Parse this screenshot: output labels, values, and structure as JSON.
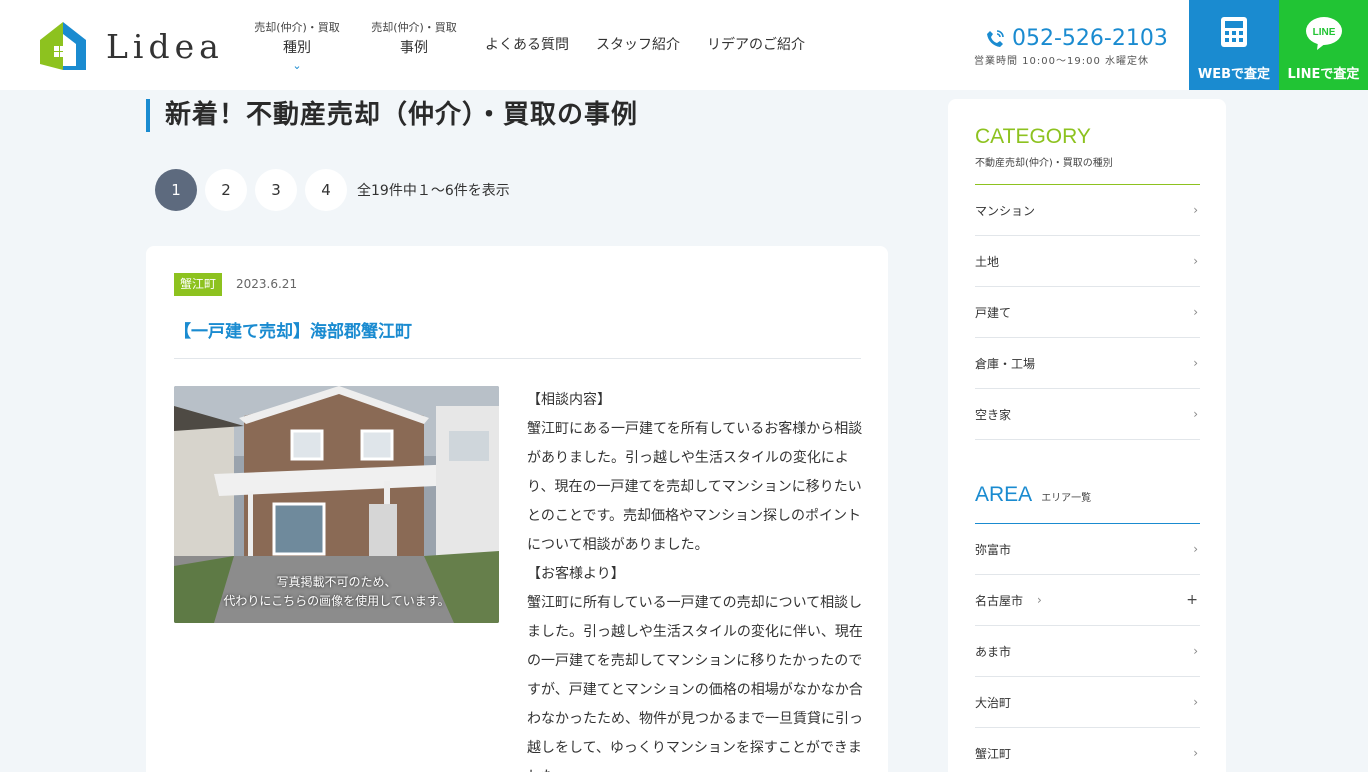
{
  "header": {
    "logo_text": "Lidea",
    "nav": [
      {
        "sub": "売却(仲介)・買取",
        "label": "種別",
        "has_chevron": true
      },
      {
        "sub": "売却(仲介)・買取",
        "label": "事例"
      },
      {
        "label": "よくある質問"
      },
      {
        "label": "スタッフ紹介"
      },
      {
        "label": "リデアのご紹介"
      }
    ],
    "phone": "052-526-2103",
    "hours": "営業時間 10:00～19:00 水曜定休",
    "cta_web": "WEBで査定",
    "cta_line": "LINEで査定",
    "line_icon_text": "LINE",
    "colors": {
      "brand_blue": "#1a8bd0",
      "brand_green": "#8dc21f",
      "line_green": "#21c434"
    }
  },
  "main": {
    "title": "新着！不動産売却（仲介）・買取の事例",
    "pages": [
      "1",
      "2",
      "3",
      "4"
    ],
    "active_page": "1",
    "pager_info": "全19件中１～6件を表示",
    "article": {
      "tag": "蟹江町",
      "date": "2023.6.21",
      "title": "【一戸建て売却】海部郡蟹江町",
      "image_caption_1": "写真掲載不可のため、",
      "image_caption_2": "代わりにこちらの画像を使用しています。",
      "body": [
        "【相談内容】",
        "蟹江町にある一戸建てを所有しているお客様から相談がありました。引っ越しや生活スタイルの変化により、現在の一戸建てを売却してマンションに移りたいとのことです。売却価格やマンション探しのポイントについて相談がありました。",
        "【お客様より】",
        "蟹江町に所有している一戸建ての売却について相談しました。引っ越しや生活スタイルの変化に伴い、現在の一戸建てを売却してマンションに移りたかったのですが、戸建てとマンションの価格の相場がなかなか合わなかったため、物件が見つかるまで一旦賃貸に引っ越しをして、ゆっくりマンションを探すことができました。"
      ]
    }
  },
  "sidebar": {
    "category_title": "CATEGORY",
    "category_sub": "不動産売却(仲介)・買取の種別",
    "categories": [
      "マンション",
      "土地",
      "戸建て",
      "倉庫・工場",
      "空き家"
    ],
    "area_title": "AREA",
    "area_sub": "エリア一覧",
    "areas": [
      "弥富市",
      "名古屋市",
      "あま市",
      "大治町",
      "蟹江町"
    ]
  }
}
